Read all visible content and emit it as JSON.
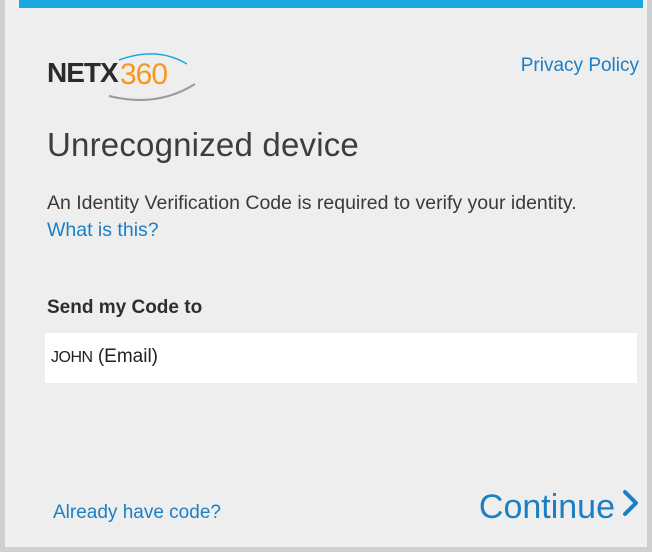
{
  "header": {
    "logo_text": "NETX360",
    "privacy_link": "Privacy Policy"
  },
  "main": {
    "title": "Unrecognized device",
    "description": "An Identity Verification Code is required to verify your identity.",
    "what_is_this_link": "What is this?",
    "send_label": "Send my Code to",
    "selected_recipient_name": "JOHN",
    "selected_recipient_type": "(Email)"
  },
  "footer": {
    "already_have_code": "Already have code?",
    "continue_label": "Continue"
  },
  "colors": {
    "accent_blue": "#1b7fc4",
    "top_bar": "#1aa8df",
    "logo_orange": "#f39a1e"
  }
}
